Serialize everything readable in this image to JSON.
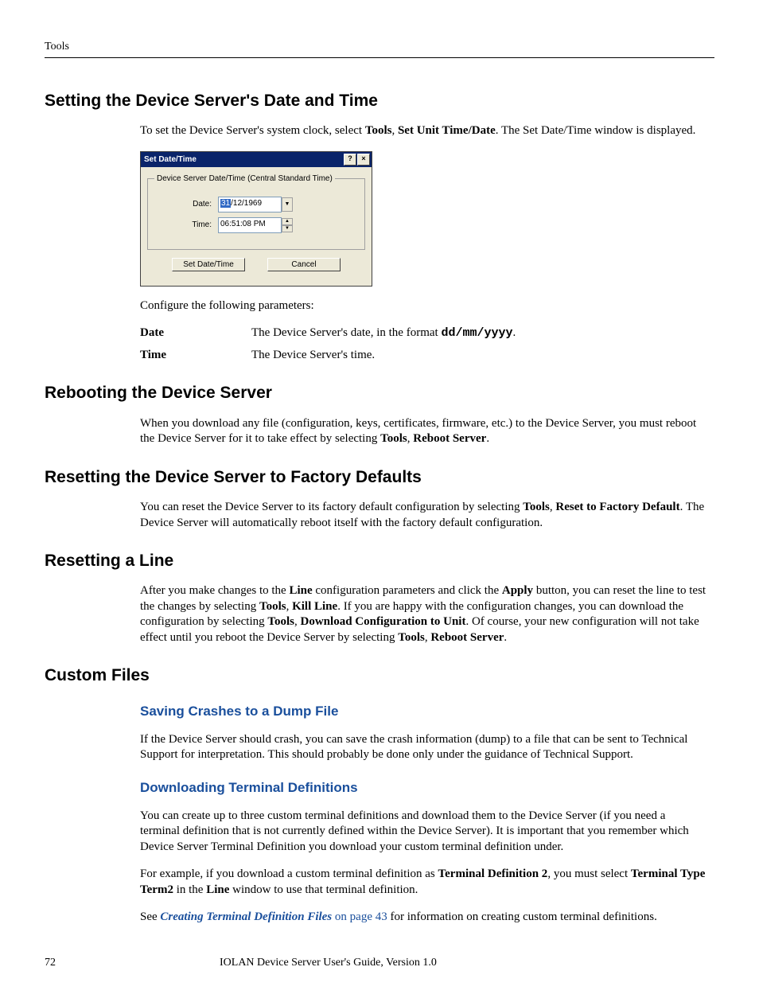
{
  "header": {
    "section": "Tools"
  },
  "s1": {
    "title": "Setting the Device Server's Date and Time",
    "p1a": "To set the Device Server's system clock, select ",
    "p1b_bold": "Tools",
    "p1c": ", ",
    "p1d_bold": "Set Unit Time/Date",
    "p1e": ". The Set Date/Time window is displayed.",
    "p2": "Configure the following parameters:",
    "params": {
      "date_label": "Date",
      "date_desc_a": "The Device Server's date, in the format ",
      "date_desc_mono": "dd/mm/yyyy",
      "date_desc_b": ".",
      "time_label": "Time",
      "time_desc": "The Device Server's time."
    }
  },
  "dlg": {
    "title": "Set Date/Time",
    "help": "?",
    "close": "×",
    "group": "Device Server Date/Time (Central Standard Time)",
    "date_label": "Date:",
    "date_sel": "31",
    "date_rest": "/12/1969",
    "time_label": "Time:",
    "time_value": "06:51:08 PM",
    "btn_set": "Set Date/Time",
    "btn_cancel": "Cancel"
  },
  "s2": {
    "title": "Rebooting the Device Server",
    "p_a": "When you download any file (configuration, keys, certificates, firmware, etc.) to the Device Server, you must reboot the Device Server for it to take effect by selecting ",
    "p_b": "Tools",
    "p_c": ", ",
    "p_d": "Reboot Server",
    "p_e": "."
  },
  "s3": {
    "title": "Resetting the Device Server to Factory Defaults",
    "p_a": "You can reset the Device Server to its factory default configuration by selecting ",
    "p_b": "Tools",
    "p_c": ", ",
    "p_d": "Reset to Factory Default",
    "p_e": ". The Device Server will automatically reboot itself with the factory default configuration."
  },
  "s4": {
    "title": "Resetting a Line",
    "p_a": "After you make changes to the ",
    "p_b": "Line",
    "p_c": " configuration parameters and click the ",
    "p_d": "Apply",
    "p_e": " button, you can reset the line to test the changes by selecting ",
    "p_f": "Tools",
    "p_g": ", ",
    "p_h": "Kill Line",
    "p_i": ". If you are happy with the configuration changes, you can download the configuration by selecting ",
    "p_j": "Tools",
    "p_k": ", ",
    "p_l": "Download Configuration to Unit",
    "p_m": ". Of course, your new configuration will not take effect until you reboot the Device Server by selecting ",
    "p_n": "Tools",
    "p_o": ", ",
    "p_p": "Reboot Server",
    "p_q": "."
  },
  "s5": {
    "title": "Custom Files",
    "sub1": {
      "title": "Saving Crashes to a Dump File",
      "p": "If the Device Server should crash, you can save the crash information (dump) to a file that can be sent to Technical Support for interpretation. This should probably be done only under the guidance of Technical Support."
    },
    "sub2": {
      "title": "Downloading Terminal Definitions",
      "p1": "You can create up to three custom terminal definitions and download them to the Device Server (if you need a terminal definition that is not currently defined within the Device Server). It is important that you remember which Device Server Terminal Definition you download your custom terminal definition under.",
      "p2_a": "For example, if you download a custom terminal definition as ",
      "p2_b": "Terminal Definition 2",
      "p2_c": ", you must select ",
      "p2_d": "Terminal Type Term2",
      "p2_e": " in the ",
      "p2_f": "Line",
      "p2_g": " window to use that terminal definition.",
      "p3_a": "See ",
      "p3_link": "Creating Terminal Definition Files",
      "p3_b": " on page 43",
      "p3_c": " for information on creating custom terminal definitions."
    }
  },
  "footer": {
    "page": "72",
    "title": "IOLAN Device Server User's Guide, Version 1.0"
  }
}
